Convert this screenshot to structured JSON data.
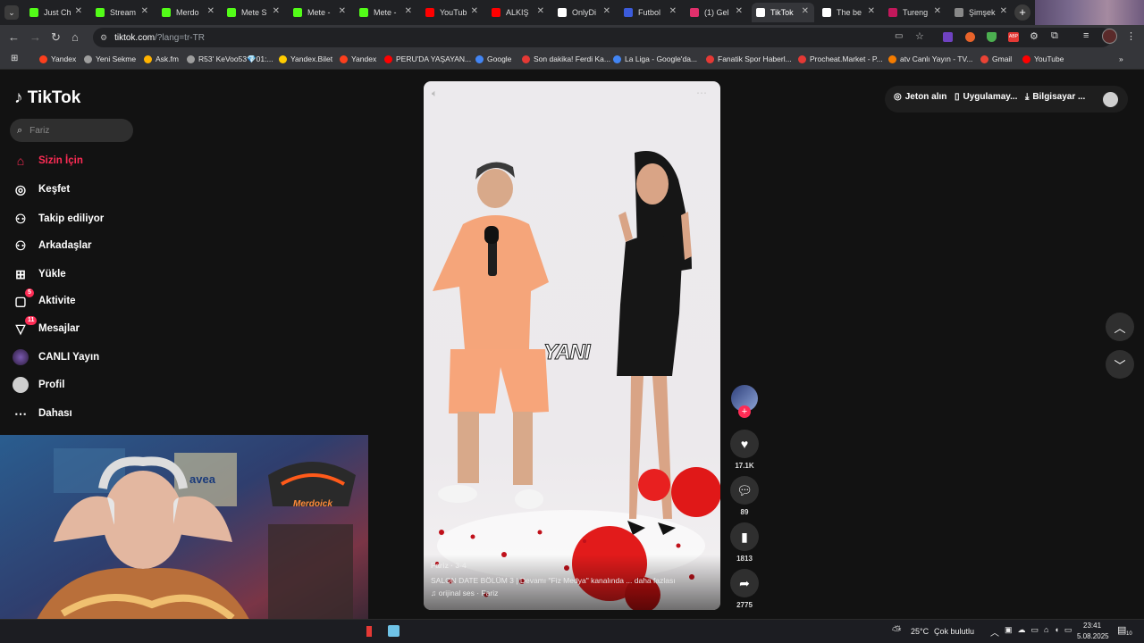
{
  "tabs": [
    {
      "label": "Just Ch",
      "color": "#53fc18"
    },
    {
      "label": "Stream",
      "color": "#53fc18"
    },
    {
      "label": "Merdo",
      "color": "#53fc18"
    },
    {
      "label": "Mete S",
      "color": "#53fc18"
    },
    {
      "label": "Mete -",
      "color": "#53fc18"
    },
    {
      "label": "Mete -",
      "color": "#53fc18"
    },
    {
      "label": "YouTub",
      "color": "#ff0000"
    },
    {
      "label": "ALKIŞ",
      "color": "#ff0000"
    },
    {
      "label": "OnlyDi",
      "color": "#ffffff"
    },
    {
      "label": "Futbol",
      "color": "#3b5bdb"
    },
    {
      "label": "(1) Gel",
      "color": "#e1306c"
    },
    {
      "label": "TikTok",
      "color": "#ffffff"
    },
    {
      "label": "The be",
      "color": "#ffffff"
    },
    {
      "label": "Tureng",
      "color": "#c2185b"
    },
    {
      "label": "Şimşek",
      "color": "#888888"
    }
  ],
  "address": {
    "host": "tiktok.com",
    "path": "/?lang=tr-TR"
  },
  "bookmarks": [
    {
      "label": "Yandex",
      "color": "#fc3f1d"
    },
    {
      "label": "Yeni Sekme",
      "color": "#9e9e9e"
    },
    {
      "label": "Ask.fm",
      "color": "#ffb300"
    },
    {
      "label": "R53' KeVoo53💎01:...",
      "color": "#9e9e9e"
    },
    {
      "label": "Yandex.Bilet",
      "color": "#ffcc00"
    },
    {
      "label": "Yandex",
      "color": "#fc3f1d"
    },
    {
      "label": "PERU'DA YAŞAYAN...",
      "color": "#ff0000"
    },
    {
      "label": "Google",
      "color": "#4285f4"
    },
    {
      "label": "Son dakika! Ferdi Ka...",
      "color": "#e53935"
    },
    {
      "label": "La Liga - Google'da...",
      "color": "#4285f4"
    },
    {
      "label": "Fanatik Spor Haberl...",
      "color": "#e53935"
    },
    {
      "label": "Procheat.Market - P...",
      "color": "#e53935"
    },
    {
      "label": "atv Canlı Yayın - TV...",
      "color": "#f57c00"
    },
    {
      "label": "Gmail",
      "color": "#ea4335"
    },
    {
      "label": "YouTube",
      "color": "#ff0000"
    }
  ],
  "tiktok": {
    "logo": "TikTok",
    "search_placeholder": "Fariz",
    "nav": [
      {
        "label": "Sizin İçin",
        "icon": "home-icon",
        "active": true
      },
      {
        "label": "Keşfet",
        "icon": "compass-icon"
      },
      {
        "label": "Takip ediliyor",
        "icon": "following-icon"
      },
      {
        "label": "Arkadaşlar",
        "icon": "friends-icon"
      },
      {
        "label": "Yükle",
        "icon": "upload-icon"
      },
      {
        "label": "Aktivite",
        "icon": "activity-icon",
        "badge": "5"
      },
      {
        "label": "Mesajlar",
        "icon": "messages-icon",
        "badge": "11"
      },
      {
        "label": "CANLI Yayın",
        "icon": "live-icon"
      },
      {
        "label": "Profil",
        "icon": "profile-icon"
      },
      {
        "label": "Dahası",
        "icon": "more-icon"
      }
    ],
    "top_buttons": {
      "coins": "Jeton alın",
      "app": "Uygulamay...",
      "desktop": "Bilgisayar ..."
    },
    "video": {
      "caption_overlay": "YANI",
      "author": "Fariz",
      "date": "Fariz · 3-4",
      "description": "SALON DATE BÖLÜM 3 | Devamı \"Fiz Medya\" kanalında ... daha fazlası",
      "sound": "♫ orijinal ses · Fariz"
    },
    "actions": {
      "likes": "17.1K",
      "comments": "89",
      "saves": "1813",
      "shares": "2775"
    }
  },
  "webcam": {
    "sign": "Merdoick",
    "brand": "avea"
  },
  "taskbar": {
    "temp": "25°C",
    "weather": "Çok bulutlu",
    "time": "23:41",
    "date": "5.08.2025",
    "notifications": "10"
  }
}
